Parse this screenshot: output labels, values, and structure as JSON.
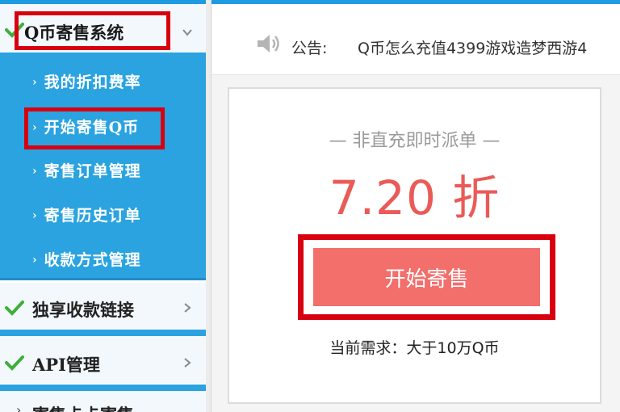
{
  "sidebar": {
    "consign_system_label": "Q币寄售系统",
    "sub_items": [
      {
        "label": "我的折扣费率"
      },
      {
        "label": "开始寄售Q币"
      },
      {
        "label": "寄售订单管理"
      },
      {
        "label": "寄售历史订单"
      },
      {
        "label": "收款方式管理"
      }
    ],
    "exclusive_link_label": "独享收款链接",
    "api_label": "API管理",
    "partial_label": "寄售卡卡寄售"
  },
  "notice": {
    "label": "公告:",
    "text": "Q币怎么充值4399游戏造梦西游4"
  },
  "card": {
    "subtitle": "— 非直充即时派单 —",
    "discount": "7.20 折",
    "start_button": "开始寄售",
    "demand": "当前需求：大于10万Q币"
  },
  "colors": {
    "accent_blue": "#2aa3e0",
    "highlight_red": "#d8000f",
    "button_red": "#f26f6c",
    "discount_red": "#ea5a57",
    "check_green": "#3fae3a"
  },
  "icons": {
    "check": "check-icon",
    "chevron": "chevron-icon",
    "speaker": "speaker-icon"
  }
}
